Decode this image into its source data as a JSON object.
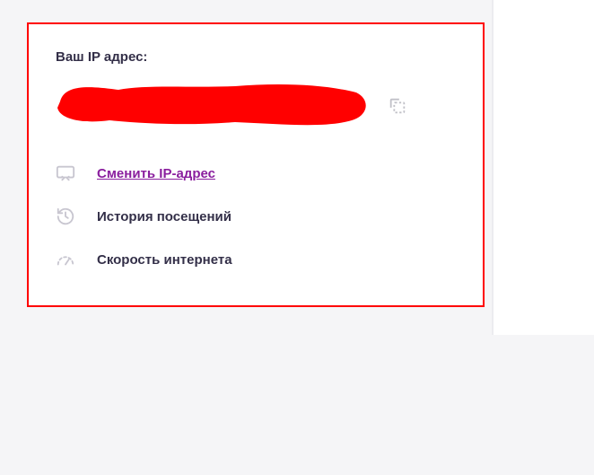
{
  "card": {
    "title": "Ваш IP адрес:",
    "ip_value_redacted": true
  },
  "links": {
    "change_ip": "Сменить IP-адрес",
    "history": "История посещений",
    "speed": "Скорость интернета"
  },
  "colors": {
    "highlight_border": "#ff0000",
    "redaction_fill": "#ff0000",
    "accent": "#8a1e9e",
    "muted_icon": "#c8c6d0",
    "text_dark": "#332f48"
  }
}
